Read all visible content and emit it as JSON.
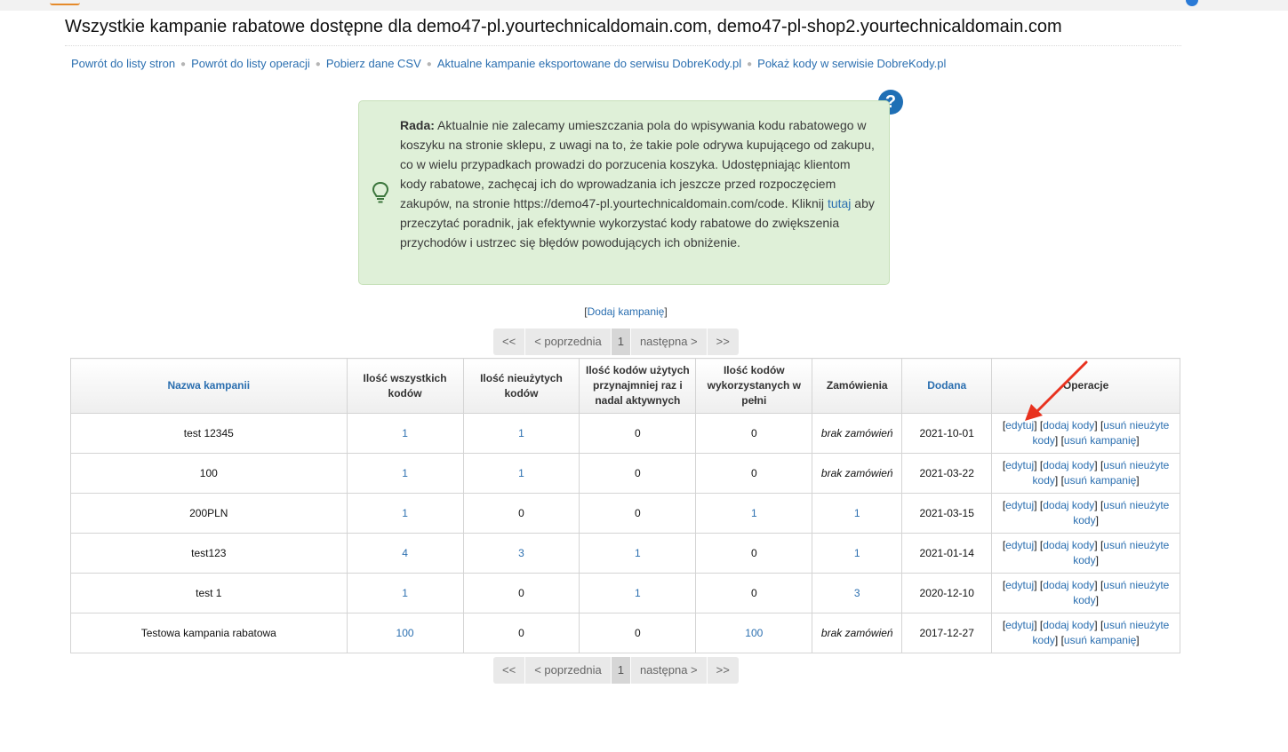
{
  "page": {
    "title": "Wszystkie kampanie rabatowe dostępne dla demo47-pl.yourtechnicaldomain.com, demo47-pl-shop2.yourtechnicaldomain.com"
  },
  "nav": [
    "Powrót do listy stron",
    "Powrót do listy operacji",
    "Pobierz dane CSV",
    "Aktualne kampanie eksportowane do serwisu DobreKody.pl",
    "Pokaż kody w serwisie DobreKody.pl"
  ],
  "help_icon": "question-icon",
  "tip": {
    "icon": "lightbulb-icon",
    "label": "Rada:",
    "text_before": "Aktualnie nie zalecamy umieszczania pola do wpisywania kodu rabatowego w koszyku na stronie sklepu, z uwagi na to, że takie pole odrywa kupującego od zakupu, co w wielu przypadkach prowadzi do porzucenia koszyka. Udostępniając klientom kody rabatowe, zachęcaj ich do wprowadzania ich jeszcze przed rozpoczęciem zakupów, na stronie https://demo47-pl.yourtechnicaldomain.com/code. Kliknij",
    "link": "tutaj",
    "text_after": "aby przeczytać poradnik, jak efektywnie wykorzystać kody rabatowe do zwiększenia przychodów i ustrzec się błędów powodujących ich obniżenie."
  },
  "add_campaign": {
    "open": "[",
    "label": "Dodaj kampanię",
    "close": "]"
  },
  "pagination": {
    "first": "<<",
    "prev": "< poprzednia",
    "current": "1",
    "next": "następna >",
    "last": ">>"
  },
  "table": {
    "headers": [
      "Nazwa kampanii",
      "Ilość wszystkich kodów",
      "Ilość nieużytych kodów",
      "Ilość kodów użytych przynajmniej raz i nadal aktywnych",
      "Ilość kodów wykorzystanych w pełni",
      "Zamówienia",
      "Dodana",
      "Operacje"
    ],
    "rows": [
      {
        "name": "test 12345",
        "all": "1",
        "unused": "1",
        "used_active": "0",
        "used_full": "0",
        "orders": "brak zamówień",
        "added": "2021-10-01",
        "has_delete_campaign": true
      },
      {
        "name": "100",
        "all": "1",
        "unused": "1",
        "used_active": "0",
        "used_full": "0",
        "orders": "brak zamówień",
        "added": "2021-03-22",
        "has_delete_campaign": true
      },
      {
        "name": "200PLN",
        "all": "1",
        "unused": "0",
        "used_active": "0",
        "used_full": "1",
        "orders": "1",
        "added": "2021-03-15",
        "has_delete_campaign": false
      },
      {
        "name": "test123",
        "all": "4",
        "unused": "3",
        "used_active": "1",
        "used_full": "0",
        "orders": "1",
        "added": "2021-01-14",
        "has_delete_campaign": false
      },
      {
        "name": "test 1",
        "all": "1",
        "unused": "0",
        "used_active": "1",
        "used_full": "0",
        "orders": "3",
        "added": "2020-12-10",
        "has_delete_campaign": false
      },
      {
        "name": "Testowa kampania rabatowa",
        "all": "100",
        "unused": "0",
        "used_active": "0",
        "used_full": "100",
        "orders": "brak zamówień",
        "added": "2017-12-27",
        "has_delete_campaign": true
      }
    ],
    "ops": {
      "edit": "edytuj",
      "add_codes": "dodaj kody",
      "delete_unused": "usuń nieużyte kody",
      "delete_campaign": "usuń kampanię"
    }
  },
  "colors": {
    "link": "#2b6fb0",
    "tip_background": "#dff0d8",
    "arrow": "#e8321f"
  }
}
